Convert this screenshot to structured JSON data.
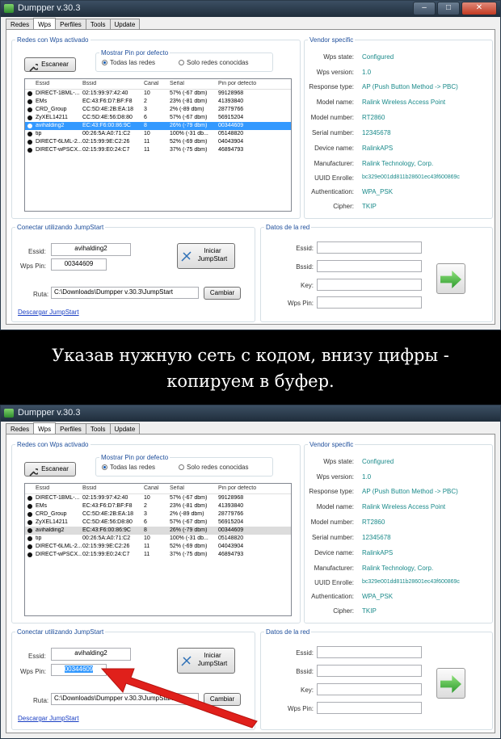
{
  "app": {
    "title": "Dumpper v.30.3",
    "tabs": [
      "Redes",
      "Wps",
      "Perfiles",
      "Tools",
      "Update"
    ],
    "window_buttons": {
      "minimize": "–",
      "maximize": "□",
      "close": "✕"
    }
  },
  "networks_panel": {
    "legend": "Redes con Wps activado",
    "scan_button": "Escanear",
    "pin_legend": "Mostrar Pin por defecto",
    "radio_all": "Todas las redes",
    "radio_known": "Solo redes conocidas",
    "columns": [
      "Essid",
      "Bssid",
      "Canal",
      "Señal",
      "Pin por defecto"
    ],
    "rows": [
      [
        "DIRECT-1BML-...",
        "02:15:99:97:42:40",
        "10",
        "57% (-67 dbm)",
        "99128968"
      ],
      [
        "EMs",
        "EC:43:F6:D7:BF:F8",
        "2",
        "23% (-81 dbm)",
        "41393840"
      ],
      [
        "CRD_Group",
        "CC:5D:4E:2B:EA:18",
        "3",
        "2% (-89 dbm)",
        "28779766"
      ],
      [
        "ZyXEL14211",
        "CC:5D:4E:56:D8:80",
        "6",
        "57% (-67 dbm)",
        "56915204"
      ],
      [
        "avihalding2",
        "EC:43:F6:00:86:9C",
        "8",
        "26% (-79 dbm)",
        "00344609"
      ],
      [
        "tip",
        "00:26:5A:A0:71:C2",
        "10",
        "100% (-31 db...",
        "05148820"
      ],
      [
        "DIRECT-6LML-2...",
        "02:15:99:9E:C2:26",
        "11",
        "52% (-69 dbm)",
        "04043904"
      ],
      [
        "DIRECT-wPSCX...",
        "02:15:99:E0:24:C7",
        "11",
        "37% (-75 dbm)",
        "46894793"
      ]
    ]
  },
  "vendor": {
    "legend": "Vendor specific",
    "fields": [
      {
        "label": "Wps state:",
        "value": "Configured"
      },
      {
        "label": "Wps version:",
        "value": "1.0"
      },
      {
        "label": "Response type:",
        "value": "AP (Push Button Method -> PBC)"
      },
      {
        "label": "Model name:",
        "value": "Ralink Wireless Access Point"
      },
      {
        "label": "Model number:",
        "value": "RT2860"
      },
      {
        "label": "Serial number:",
        "value": "12345678"
      },
      {
        "label": "Device name:",
        "value": "RalinkAPS"
      },
      {
        "label": "Manufacturer:",
        "value": "Ralink Technology, Corp."
      },
      {
        "label": "UUID Enrolle:",
        "value": "bc329e001dd811b28601ec43f600869c"
      },
      {
        "label": "Authentication:",
        "value": "WPA_PSK"
      },
      {
        "label": "Cipher:",
        "value": "TKIP"
      }
    ]
  },
  "jumpstart": {
    "legend": "Conectar utilizando JumpStart",
    "essid_label": "Essid:",
    "essid_value": "avihalding2",
    "pin_label": "Wps Pin:",
    "pin_value": "00344609",
    "start_button_line1": "Iniciar",
    "start_button_line2": "JumpStart",
    "path_label": "Ruta:",
    "path_value": "C:\\Downloads\\Dumpper v.30.3\\JumpStart",
    "change_button": "Cambiar",
    "download_link": "Descargar JumpStart"
  },
  "network_data": {
    "legend": "Datos de la red",
    "labels": [
      "Essid:",
      "Bssid:",
      "Key:",
      "Wps Pin:"
    ]
  },
  "caption": {
    "line1": "Указав нужную сеть с кодом, внизу цифры -",
    "line2": "копируем в буфер."
  },
  "annotation": {
    "arrow_color": "#e0201b"
  }
}
